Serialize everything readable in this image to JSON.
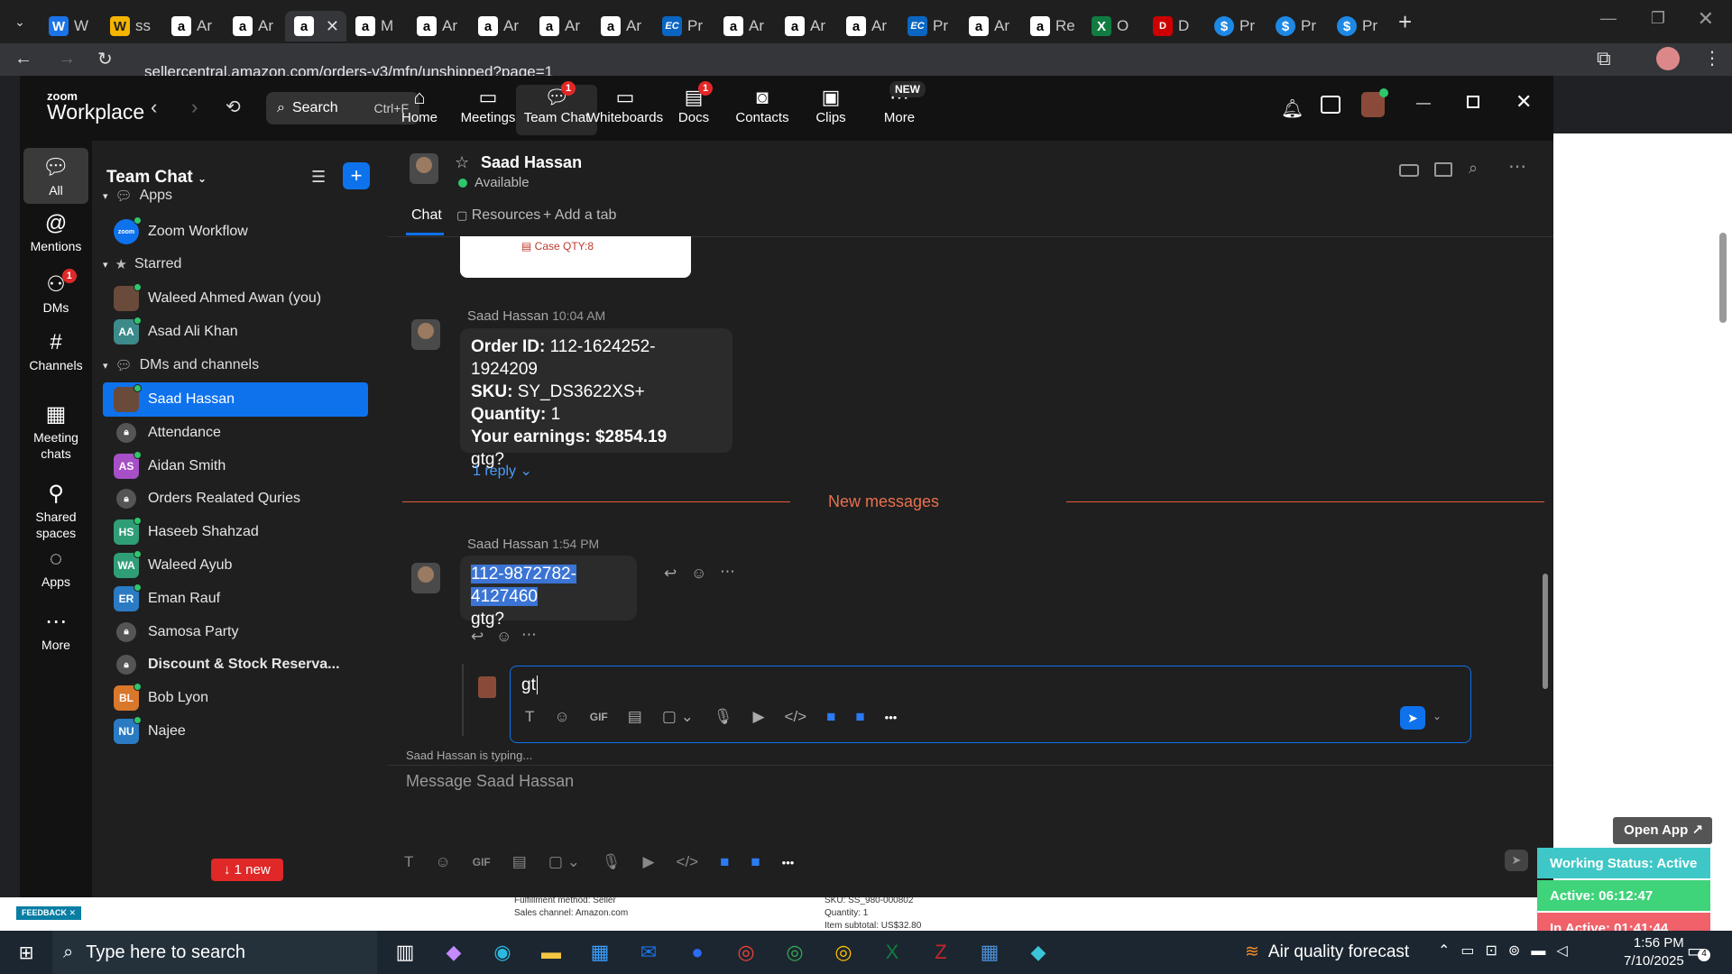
{
  "browser": {
    "tabs": [
      {
        "icon": "w",
        "label": "W"
      },
      {
        "icon": "y",
        "label": "ss"
      },
      {
        "icon": "amz",
        "label": "Ar"
      },
      {
        "icon": "amz",
        "label": "Ar"
      },
      {
        "icon": "amz",
        "label": "",
        "active": true
      },
      {
        "icon": "amz",
        "label": "M"
      },
      {
        "icon": "amz",
        "label": "Ar"
      },
      {
        "icon": "amz",
        "label": "Ar"
      },
      {
        "icon": "amz",
        "label": "Ar"
      },
      {
        "icon": "amz",
        "label": "Ar"
      },
      {
        "icon": "ec",
        "label": "Pr"
      },
      {
        "icon": "amz",
        "label": "Ar"
      },
      {
        "icon": "amz",
        "label": "Ar"
      },
      {
        "icon": "amz",
        "label": "Ar"
      },
      {
        "icon": "ec",
        "label": "Pr"
      },
      {
        "icon": "amz",
        "label": "Ar"
      },
      {
        "icon": "amz",
        "label": "Re"
      },
      {
        "icon": "xl",
        "label": "O"
      },
      {
        "icon": "r",
        "label": "D"
      },
      {
        "icon": "s",
        "label": "Pr"
      },
      {
        "icon": "s",
        "label": "Pr"
      },
      {
        "icon": "s",
        "label": "Pr"
      }
    ],
    "url": "sellercentral.amazon.com/orders-v3/mfn/unshipped?page=1"
  },
  "zoom": {
    "logo_top": "zoom",
    "logo_bottom": "Workplace",
    "search_label": "Search",
    "search_shortcut": "Ctrl+F",
    "nav": [
      {
        "label": "Home",
        "icon": "home-icon"
      },
      {
        "label": "Meetings",
        "icon": "video-icon"
      },
      {
        "label": "Team Chat",
        "icon": "chat-icon",
        "badge": "1",
        "active": true
      },
      {
        "label": "Whiteboards",
        "icon": "whiteboard-icon"
      },
      {
        "label": "Docs",
        "icon": "docs-icon",
        "badge": "1"
      },
      {
        "label": "Contacts",
        "icon": "contacts-icon"
      },
      {
        "label": "Clips",
        "icon": "clips-icon"
      },
      {
        "label": "More",
        "icon": "more-icon",
        "tag": "NEW"
      }
    ],
    "rail": [
      {
        "label": "All",
        "icon": "chat-icon",
        "active": true
      },
      {
        "label": "Mentions",
        "icon": "at-icon"
      },
      {
        "label": "DMs",
        "icon": "dms-icon",
        "badge": "1"
      },
      {
        "label": "Channels",
        "icon": "hash-icon"
      },
      {
        "label": "Meeting chats",
        "icon": "calendar-icon"
      },
      {
        "label": "Shared spaces",
        "icon": "shared-icon"
      },
      {
        "label": "Apps",
        "icon": "apps-icon"
      },
      {
        "label": "More",
        "icon": "more-icon"
      }
    ],
    "side": {
      "title": "Team Chat",
      "sections": {
        "apps": "Apps",
        "starred": "Starred",
        "dms": "DMs and channels"
      },
      "apps": [
        {
          "name": "Zoom Workflow"
        }
      ],
      "starred": [
        {
          "name": "Waleed Ahmed Awan (you)",
          "av": "photo"
        },
        {
          "name": "Asad Ali Khan",
          "av": "AA",
          "color": "#3d8a8a"
        }
      ],
      "dms": [
        {
          "name": "Saad Hassan",
          "av": "photo",
          "selected": true
        },
        {
          "name": "Attendance",
          "av": "lock"
        },
        {
          "name": "Aidan Smith",
          "av": "AS",
          "color": "#a64fc6"
        },
        {
          "name": "Orders Realated Quries",
          "av": "lock"
        },
        {
          "name": "Haseeb Shahzad",
          "av": "HS",
          "color": "#2f9e77"
        },
        {
          "name": "Waleed Ayub",
          "av": "WA",
          "color": "#2f9e77"
        },
        {
          "name": "Eman Rauf",
          "av": "ER",
          "color": "#2a7bc4"
        },
        {
          "name": "Samosa Party",
          "av": "lock"
        },
        {
          "name": "Discount & Stock Reserva...",
          "av": "lock",
          "bold": true
        },
        {
          "name": "Bob Lyon",
          "av": "BL",
          "color": "#d9772b"
        },
        {
          "name": "Najee",
          "av": "NU",
          "color": "#2a7bc4"
        }
      ],
      "new_badge": "↓ 1 new"
    },
    "chat": {
      "contact_name": "Saad Hassan",
      "contact_status": "Available",
      "tabs": [
        "Chat",
        "Resources",
        "Add a tab"
      ],
      "prev_card_text": "Case QTY:8",
      "msg1": {
        "sender": "Saad Hassan",
        "time": "10:04 AM",
        "lines": [
          {
            "k": "Order ID:",
            "v": " 112-1624252-1924209"
          },
          {
            "k": "SKU:",
            "v": " SY_DS3622XS+"
          },
          {
            "k": "Quantity:",
            "v": " 1"
          },
          {
            "k": "Your earnings: $2854.19",
            "v": ""
          }
        ],
        "tail": "gtg?",
        "reply": "1 reply"
      },
      "divider": "New messages",
      "msg2": {
        "sender": "Saad Hassan",
        "time": "1:54 PM",
        "highlight": "112-9872782-4127460",
        "tail": "gtg?"
      },
      "reply_draft": "gt",
      "typing": "Saad Hassan is typing...",
      "composer_placeholder": "Message Saad Hassan"
    }
  },
  "overlay": {
    "open_app": "Open App ↗",
    "working": "Working Status: Active",
    "active": "Active: 06:12:47",
    "inactive": "In Active: 01:41:44",
    "feedback": "FEEDBACK",
    "bg_texts": [
      "Fulfillment method: Seller",
      "Sales channel: Amazon.com",
      "SKU: SS_980-000802",
      "Quantity: 1",
      "Item subtotal: US$32.80"
    ]
  },
  "taskbar": {
    "search_placeholder": "Type here to search",
    "weather": "Air quality forecast",
    "time": "1:56 PM",
    "date": "7/10/2025",
    "notif": "4"
  }
}
